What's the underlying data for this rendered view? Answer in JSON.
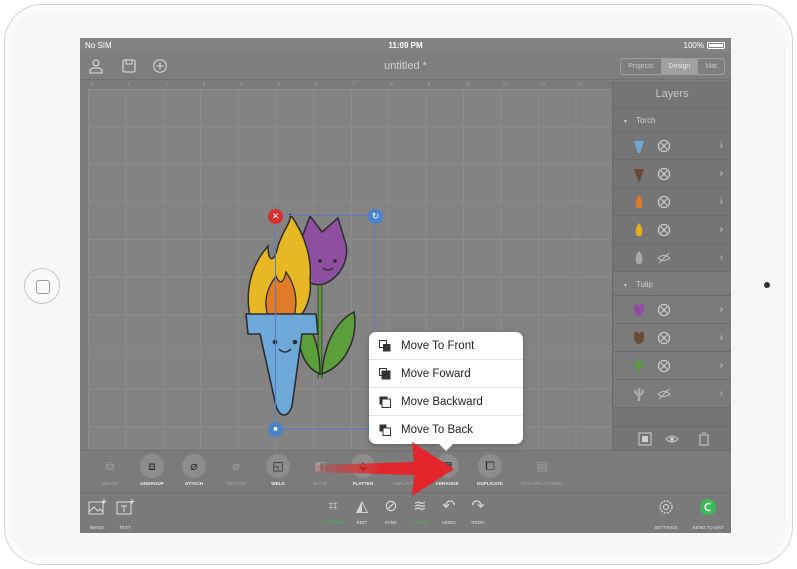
{
  "status_bar": {
    "carrier": "No SIM",
    "time": "11:09 PM",
    "battery": "100%"
  },
  "header": {
    "title": "untitled *",
    "icons": [
      "user-icon",
      "save-icon",
      "add-icon"
    ],
    "segments": [
      {
        "label": "Projects",
        "active": false
      },
      {
        "label": "Design",
        "active": true
      },
      {
        "label": "Mat",
        "active": false
      }
    ]
  },
  "ruler": {
    "ticks": [
      "0",
      "1",
      "2",
      "3",
      "4",
      "5",
      "6",
      "7",
      "8",
      "9",
      "10",
      "11",
      "12",
      "13"
    ]
  },
  "layers_panel": {
    "title": "Layers",
    "groups": [
      {
        "name": "Torch",
        "layers": [
          {
            "color": "#6ea8d8",
            "shape": "cone-icon",
            "visible": true
          },
          {
            "color": "#6b4a33",
            "shape": "cone-icon",
            "visible": true
          },
          {
            "color": "#e07b2a",
            "shape": "flame-icon",
            "visible": true
          },
          {
            "color": "#e0b020",
            "shape": "flame-icon",
            "visible": true
          },
          {
            "color": "#bbbbbb",
            "shape": "flame-icon",
            "visible": false
          }
        ]
      },
      {
        "name": "Tulip",
        "layers": [
          {
            "color": "#8e4fa0",
            "shape": "tulip-icon",
            "visible": true
          },
          {
            "color": "#6b4a33",
            "shape": "tulip-icon",
            "visible": true
          },
          {
            "color": "#5b9e3a",
            "shape": "stem-icon",
            "visible": true
          },
          {
            "color": "#bbbbbb",
            "shape": "stem-icon",
            "visible": false
          }
        ]
      }
    ],
    "footer_icons": [
      "group-layer-icon",
      "eye-icon",
      "trash-icon"
    ]
  },
  "toolbar": {
    "buttons": [
      {
        "label": "GROUP",
        "enabled": false,
        "icon": "group-icon"
      },
      {
        "label": "UNGROUP",
        "enabled": true,
        "icon": "ungroup-icon"
      },
      {
        "label": "ATTACH",
        "enabled": true,
        "icon": "attach-icon"
      },
      {
        "label": "DETACH",
        "enabled": false,
        "icon": "detach-icon"
      },
      {
        "label": "WELD",
        "enabled": true,
        "icon": "weld-icon"
      },
      {
        "label": "SLICE",
        "enabled": false,
        "icon": "slice-icon"
      },
      {
        "label": "FLATTEN",
        "enabled": true,
        "icon": "flatten-icon"
      },
      {
        "label": "UNFLATTEN",
        "enabled": false,
        "icon": "unflatten-icon"
      },
      {
        "label": "ARRANGE",
        "enabled": true,
        "icon": "arrange-icon"
      },
      {
        "label": "DUPLICATE",
        "enabled": true,
        "icon": "duplicate-icon"
      },
      {
        "label": "ISOLATE LETTERS",
        "enabled": false,
        "icon": "isolate-letters-icon"
      }
    ]
  },
  "bottom_bar": {
    "left": [
      {
        "label": "IMAGE",
        "icon": "image-icon"
      },
      {
        "label": "TEXT",
        "icon": "text-icon"
      }
    ],
    "center": [
      {
        "label": "ACTIONS",
        "icon": "actions-icon",
        "active": true
      },
      {
        "label": "EDIT",
        "icon": "edit-icon",
        "active": false
      },
      {
        "label": "SYNC",
        "icon": "sync-icon",
        "active": false
      },
      {
        "label": "LAYERS",
        "icon": "layers-icon",
        "active": true
      },
      {
        "label": "UNDO",
        "icon": "undo-icon",
        "active": false
      },
      {
        "label": "REDO",
        "icon": "redo-icon",
        "active": false
      }
    ],
    "right": [
      {
        "label": "SETTINGS",
        "icon": "settings-icon"
      },
      {
        "label": "SEND TO MAT",
        "icon": "send-to-mat-icon"
      }
    ]
  },
  "arrange_menu": {
    "items": [
      {
        "label": "Move To Front",
        "icon": "move-to-front-icon"
      },
      {
        "label": "Move Foward",
        "icon": "move-forward-icon"
      },
      {
        "label": "Move Backward",
        "icon": "move-backward-icon"
      },
      {
        "label": "Move To Back",
        "icon": "move-to-back-icon"
      }
    ]
  },
  "colors": {
    "annotation_arrow": "#e3262b",
    "accent_green": "#3bbb55",
    "delete_handle": "#d92c2c",
    "handle_blue": "#4a83c9"
  }
}
